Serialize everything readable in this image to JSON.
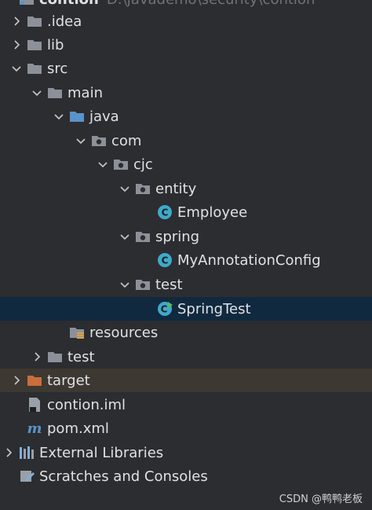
{
  "colors": {
    "background": "#2b2d30",
    "selected_row": "#10293f",
    "excluded_row": "#3d3832",
    "folder": "#8c9199",
    "source_folder": "#5a93c9",
    "excluded_folder": "#c86e3a",
    "class_icon": "#3fa9c9"
  },
  "tree": [
    {
      "label": "contion",
      "extra": "D:\\javademo\\security\\contion",
      "icon": "module-icon",
      "arrow": "none",
      "cut": true
    },
    {
      "label": ".idea",
      "icon": "folder-icon",
      "arrow": "right"
    },
    {
      "label": "lib",
      "icon": "folder-icon",
      "arrow": "right"
    },
    {
      "label": "src",
      "icon": "folder-icon",
      "arrow": "down"
    },
    {
      "label": "main",
      "icon": "folder-icon",
      "arrow": "down"
    },
    {
      "label": "java",
      "icon": "source-folder-icon",
      "arrow": "down"
    },
    {
      "label": "com",
      "icon": "package-icon",
      "arrow": "down"
    },
    {
      "label": "cjc",
      "icon": "package-icon",
      "arrow": "down"
    },
    {
      "label": "entity",
      "icon": "package-icon",
      "arrow": "down"
    },
    {
      "label": "Employee",
      "icon": "class-icon",
      "arrow": "none"
    },
    {
      "label": "spring",
      "icon": "package-icon",
      "arrow": "down"
    },
    {
      "label": "MyAnnotationConfig",
      "icon": "class-icon",
      "arrow": "none"
    },
    {
      "label": "test",
      "icon": "package-icon",
      "arrow": "down"
    },
    {
      "label": "SpringTest",
      "icon": "runnable-class-icon",
      "arrow": "none",
      "selected": true
    },
    {
      "label": "resources",
      "icon": "resources-folder-icon",
      "arrow": "none"
    },
    {
      "label": "test",
      "icon": "folder-icon",
      "arrow": "right"
    },
    {
      "label": "target",
      "icon": "excluded-folder-icon",
      "arrow": "right",
      "excluded": true
    },
    {
      "label": "contion.iml",
      "icon": "iml-file-icon",
      "arrow": "none"
    },
    {
      "label": "pom.xml",
      "icon": "maven-icon",
      "arrow": "none"
    },
    {
      "label": "External Libraries",
      "icon": "libraries-icon",
      "arrow": "right"
    },
    {
      "label": "Scratches and Consoles",
      "icon": "scratches-icon",
      "arrow": "none"
    }
  ],
  "watermark": "CSDN @鸭鸭老板"
}
